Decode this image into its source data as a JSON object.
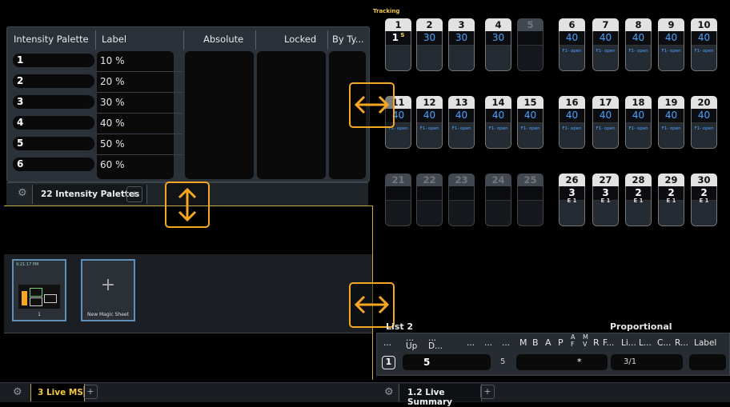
{
  "palette": {
    "columns": [
      "Intensity Palette",
      "Label",
      "Absolute",
      "Locked",
      "By Ty..."
    ],
    "rows": [
      {
        "id": "1",
        "label": "10 %"
      },
      {
        "id": "2",
        "label": "20 %"
      },
      {
        "id": "3",
        "label": "30 %"
      },
      {
        "id": "4",
        "label": "40 %"
      },
      {
        "id": "5",
        "label": "50 %"
      },
      {
        "id": "6",
        "label": "60 %"
      }
    ],
    "tab_label": "22 Intensity Palettes"
  },
  "tracking_label": "Tracking",
  "channels": [
    {
      "n": "1",
      "v": "1",
      "mark": "S",
      "style": "white"
    },
    {
      "n": "2",
      "v": "30"
    },
    {
      "n": "3",
      "v": "30"
    },
    {
      "n": "4",
      "v": "30"
    },
    {
      "n": "5",
      "v": "",
      "dim": true
    },
    {
      "n": "6",
      "v": "40",
      "sub": "F1- open"
    },
    {
      "n": "7",
      "v": "40",
      "sub": "F1- open"
    },
    {
      "n": "8",
      "v": "40",
      "sub": "F1- open"
    },
    {
      "n": "9",
      "v": "40",
      "sub": "F1- open"
    },
    {
      "n": "10",
      "v": "40",
      "sub": "F1- open"
    },
    {
      "n": "11",
      "v": "40",
      "sub": "F1- open"
    },
    {
      "n": "12",
      "v": "40",
      "sub": "F1- open"
    },
    {
      "n": "13",
      "v": "40",
      "sub": "F1- open"
    },
    {
      "n": "14",
      "v": "40",
      "sub": "F1- open"
    },
    {
      "n": "15",
      "v": "40",
      "sub": "F1- open"
    },
    {
      "n": "16",
      "v": "40",
      "sub": "F1- open"
    },
    {
      "n": "17",
      "v": "40",
      "sub": "F1- open"
    },
    {
      "n": "18",
      "v": "40",
      "sub": "F1- open"
    },
    {
      "n": "19",
      "v": "40",
      "sub": "F1- open"
    },
    {
      "n": "20",
      "v": "40",
      "sub": "F1- open"
    },
    {
      "n": "21",
      "v": "",
      "dim": true
    },
    {
      "n": "22",
      "v": "",
      "dim": true
    },
    {
      "n": "23",
      "v": "",
      "dim": true
    },
    {
      "n": "24",
      "v": "",
      "dim": true
    },
    {
      "n": "25",
      "v": "",
      "dim": true
    },
    {
      "n": "26",
      "v": "3",
      "e": "E 1"
    },
    {
      "n": "27",
      "v": "3",
      "e": "E 1"
    },
    {
      "n": "28",
      "v": "2",
      "e": "E 1"
    },
    {
      "n": "29",
      "v": "2",
      "e": "E 1"
    },
    {
      "n": "30",
      "v": "2",
      "e": "E 1"
    }
  ],
  "magic_sheets": {
    "time": "9:21:17 PM",
    "sheet1_label": "1",
    "new_label": "New Magic Sheet"
  },
  "summary": {
    "list_label": "List 2",
    "proportional_label": "Proportional",
    "headers": [
      "...",
      "...\nUp",
      "...\nD...",
      "...",
      "...",
      "...",
      "M",
      "B",
      "A",
      "P",
      "A\nF",
      "M\nV",
      "R",
      "F...",
      "Li...",
      "L...",
      "C...",
      "R...",
      "Label"
    ],
    "cue": "1",
    "time": "5",
    "delay": "5",
    "mark": "*",
    "part": "3/1"
  },
  "bottom_tabs": {
    "left": "3 Live MS",
    "right": "1.2 Live Summary"
  },
  "colors": {
    "accent": "#f5a623",
    "blue": "#4aa3ff",
    "yellow": "#ffe04d"
  }
}
